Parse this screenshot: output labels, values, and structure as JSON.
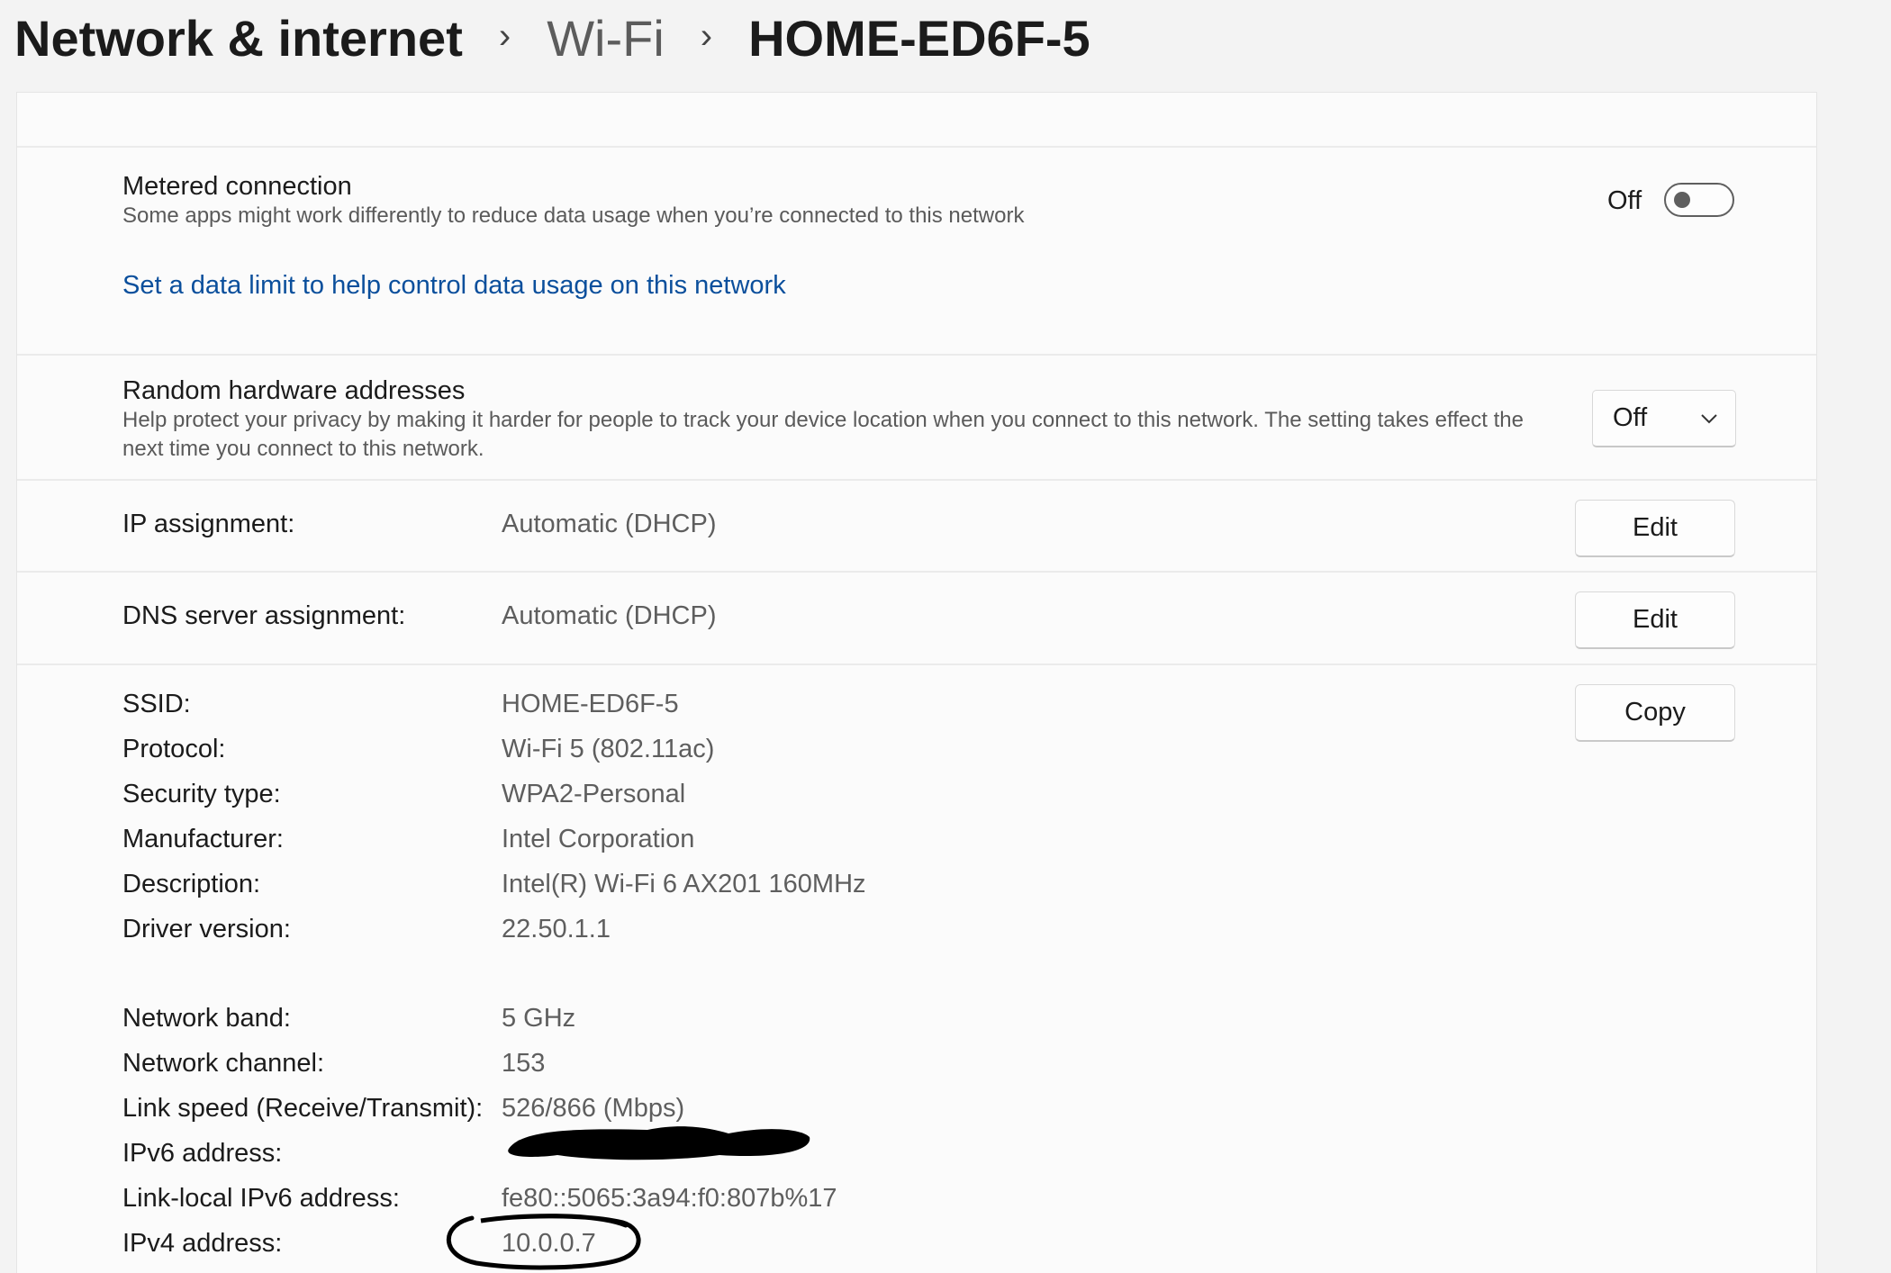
{
  "breadcrumb": {
    "item1": "Network & internet",
    "item2": "Wi-Fi",
    "item3": "HOME-ED6F-5",
    "separator": "›"
  },
  "metered": {
    "title": "Metered connection",
    "description": "Some apps might work differently to reduce data usage when you’re connected to this network",
    "toggle_state": "Off",
    "data_limit_link": "Set a data limit to help control data usage on this network"
  },
  "random_hw": {
    "title": "Random hardware addresses",
    "description": "Help protect your privacy by making it harder for people to track your device location when you connect to this network. The setting takes effect the next time you connect to this network.",
    "selected": "Off"
  },
  "ip_assignment": {
    "label": "IP assignment:",
    "value": "Automatic (DHCP)",
    "button": "Edit"
  },
  "dns_assignment": {
    "label": "DNS server assignment:",
    "value": "Automatic (DHCP)",
    "button": "Edit"
  },
  "properties": {
    "copy_button": "Copy",
    "ssid": {
      "label": "SSID:",
      "value": "HOME-ED6F-5"
    },
    "protocol": {
      "label": "Protocol:",
      "value": "Wi-Fi 5 (802.11ac)"
    },
    "security": {
      "label": "Security type:",
      "value": "WPA2-Personal"
    },
    "manufacturer": {
      "label": "Manufacturer:",
      "value": "Intel Corporation"
    },
    "description": {
      "label": "Description:",
      "value": "Intel(R) Wi-Fi 6 AX201 160MHz"
    },
    "driver": {
      "label": "Driver version:",
      "value": "22.50.1.1"
    },
    "band": {
      "label": "Network band:",
      "value": "5 GHz"
    },
    "channel": {
      "label": "Network channel:",
      "value": "153"
    },
    "link_speed": {
      "label": "Link speed (Receive/Transmit):",
      "value": "526/866 (Mbps)"
    },
    "ipv6": {
      "label": "IPv6 address:"
    },
    "link_local": {
      "label": "Link-local IPv6 address:",
      "value": "fe80::5065:3a94:f0:807b%17"
    },
    "ipv4": {
      "label": "IPv4 address:",
      "value": "10.0.0.7"
    }
  },
  "colors": {
    "link": "#0b4f9c",
    "panel": "#fbfbfb",
    "background": "#f3f3f3"
  }
}
